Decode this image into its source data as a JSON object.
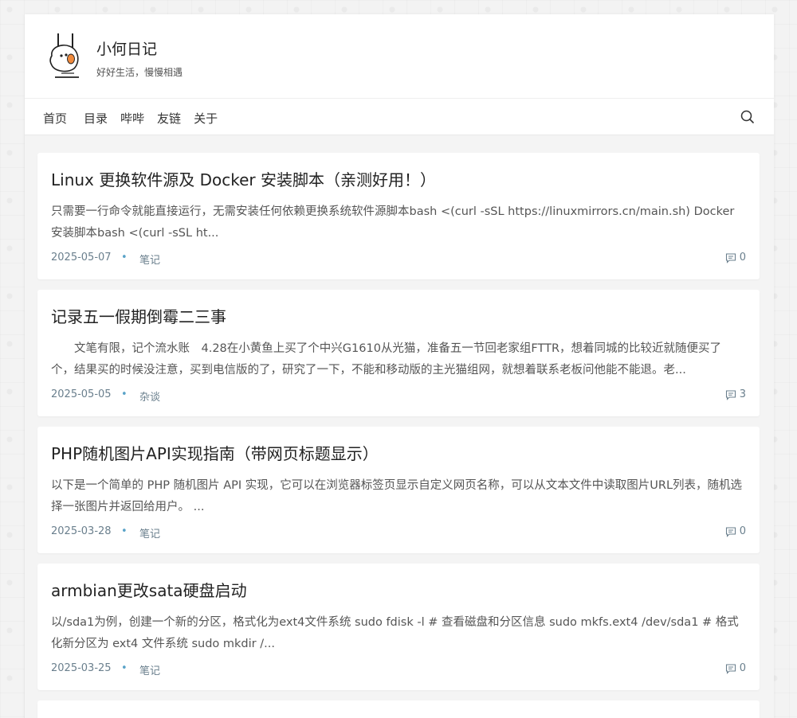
{
  "site": {
    "title": "小何日记",
    "subtitle": "好好生活，慢慢相遇"
  },
  "nav": {
    "items": [
      {
        "label": "首页"
      },
      {
        "label": "目录"
      },
      {
        "label": "哔哔"
      },
      {
        "label": "友链"
      },
      {
        "label": "关于"
      }
    ]
  },
  "posts": [
    {
      "title": "Linux 更换软件源及 Docker 安装脚本（亲测好用！）",
      "excerpt": "只需要一行命令就能直接运行，无需安装任何依赖更换系统软件源脚本bash <(curl -sSL https://linuxmirrors.cn/main.sh) Docker 安装脚本bash <(curl -sSL ht...",
      "date": "2025-05-07",
      "dot": "•",
      "category": "笔记",
      "comments": "0"
    },
    {
      "title": "记录五一假期倒霉二三事",
      "excerpt": "　　文笔有限，记个流水账　4.28在小黄鱼上买了个中兴G1610从光猫，准备五一节回老家组FTTR，想着同城的比较近就随便买了个，结果买的时候没注意，买到电信版的了，研究了一下，不能和移动版的主光猫组网，就想着联系老板问他能不能退。老...",
      "date": "2025-05-05",
      "dot": "•",
      "category": "杂谈",
      "comments": "3"
    },
    {
      "title": "PHP随机图片API实现指南（带网页标题显示）",
      "excerpt": "以下是一个简单的 PHP 随机图片 API 实现，它可以在浏览器标签页显示自定义网页名称，可以从文本文件中读取图片URL列表，随机选择一张图片并返回给用户。 ...",
      "date": "2025-03-28",
      "dot": "•",
      "category": "笔记",
      "comments": "0"
    },
    {
      "title": "armbian更改sata硬盘启动",
      "excerpt": "以/sda1为例，创建一个新的分区，格式化为ext4文件系统 sudo fdisk -l # 查看磁盘和分区信息 sudo mkfs.ext4 /dev/sda1 # 格式化新分区为 ext4 文件系统 sudo mkdir /...",
      "date": "2025-03-25",
      "dot": "•",
      "category": "笔记",
      "comments": "0"
    }
  ]
}
